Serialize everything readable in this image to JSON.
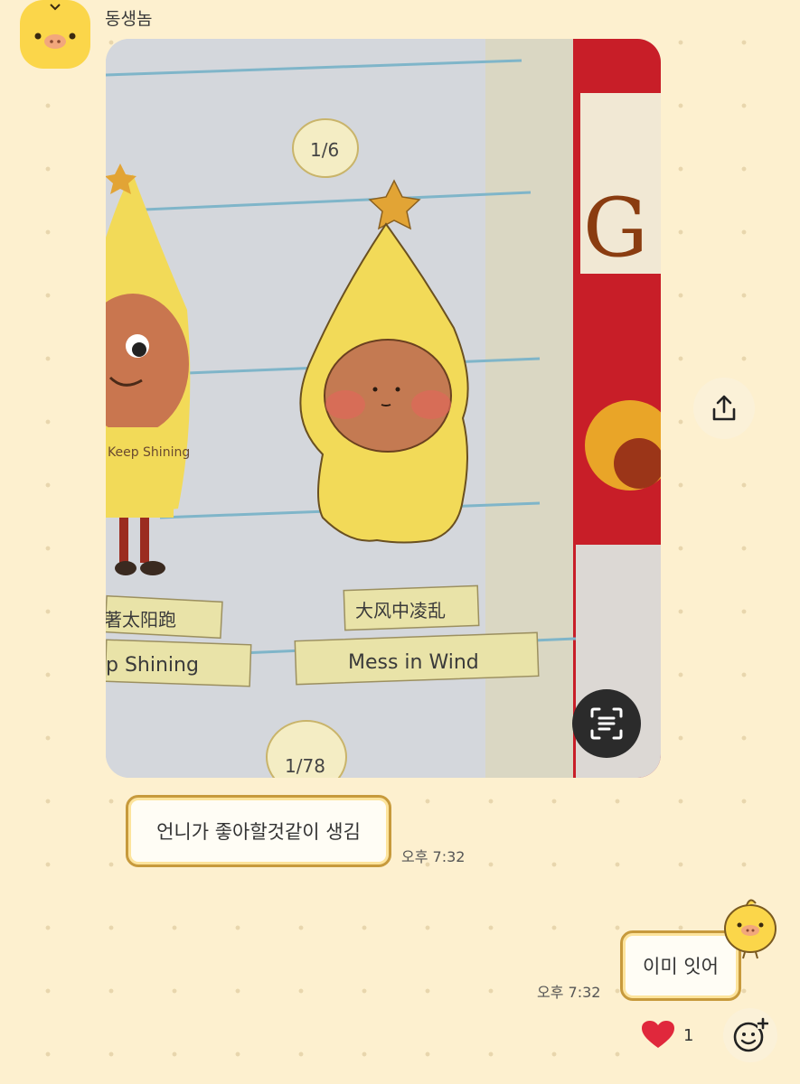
{
  "message_in": {
    "sender": "동생놈",
    "text": "언니가 좋아할것같이 생김",
    "time": "오후 7:32",
    "photo": {
      "badge_top": "1/6",
      "badge_bottom": "1/78",
      "label_left_cn": "著太阳跑",
      "label_left_en": "p Shining",
      "label_center_cn": "大风中凌乱",
      "label_center_en": "Mess in Wind",
      "shirt_text": "Keep Shining",
      "box_text": "G"
    }
  },
  "message_out": {
    "text": "이미 잇어",
    "time": "오후 7:32"
  },
  "reaction": {
    "icon": "heart-icon",
    "count": "1",
    "color": "#e0283c"
  },
  "buttons": {
    "share_icon": "share-icon",
    "scan_icon": "text-scan-icon",
    "add_reaction_icon": "add-reaction-icon"
  },
  "colors": {
    "background": "#fdf0cf",
    "bubble_border": "#c79a3c",
    "bubble_inner": "#fde49c",
    "avatar": "#fbd64a"
  }
}
